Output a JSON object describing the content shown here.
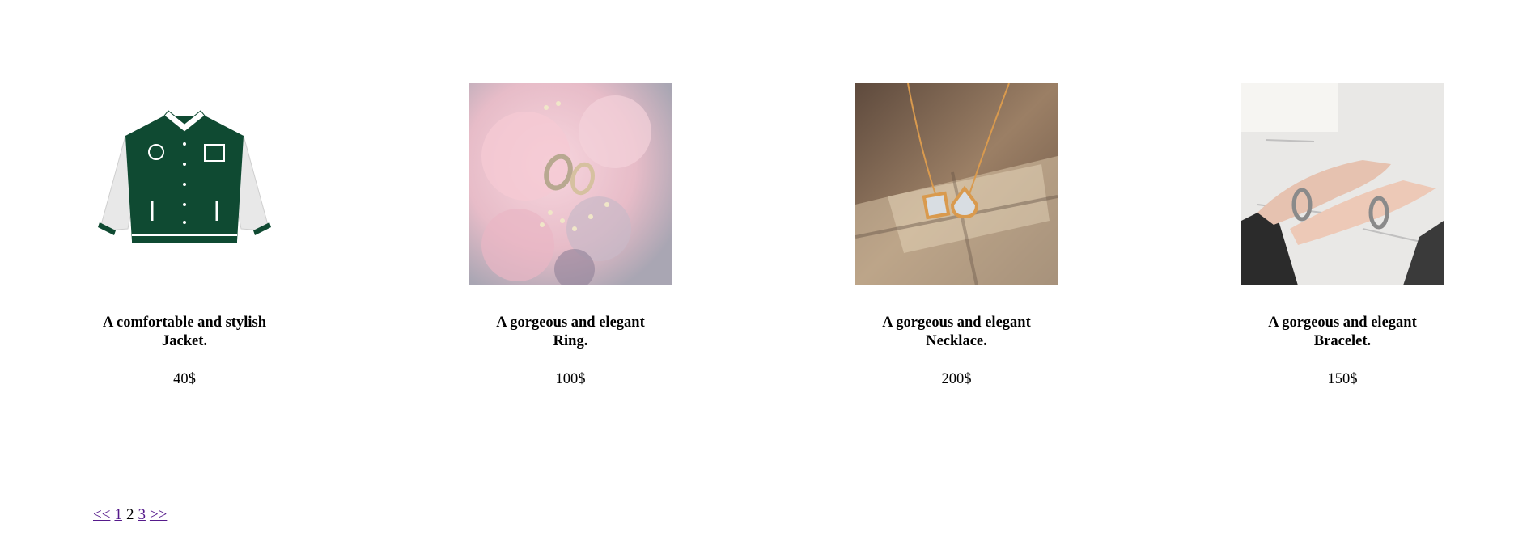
{
  "products": [
    {
      "title": "A comfortable and stylish Jacket.",
      "price": "40$",
      "image_icon": "jacket-icon"
    },
    {
      "title": "A gorgeous and elegant Ring.",
      "price": "100$",
      "image_icon": "ring-icon"
    },
    {
      "title": "A gorgeous and elegant Necklace.",
      "price": "200$",
      "image_icon": "necklace-icon"
    },
    {
      "title": "A gorgeous and elegant Bracelet.",
      "price": "150$",
      "image_icon": "bracelet-icon"
    }
  ],
  "pagination": {
    "prev": "<<",
    "pages": [
      "1",
      "2",
      "3"
    ],
    "current": "2",
    "next": ">>"
  },
  "colors": {
    "link": "#551a8b",
    "jacket_body": "#0f4a32"
  }
}
